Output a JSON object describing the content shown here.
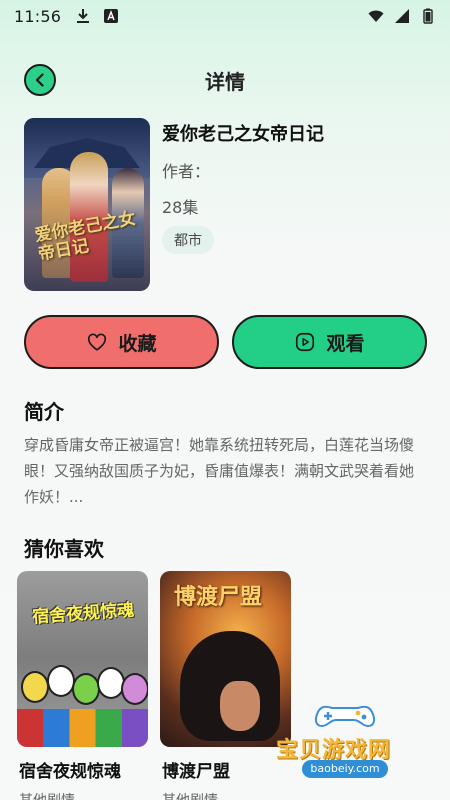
{
  "status_bar": {
    "time": "11:56"
  },
  "header": {
    "title": "详情"
  },
  "drama": {
    "title": "爱你老己之女帝日记",
    "author_label": "作者：",
    "episodes": "28集",
    "tag": "都市",
    "cover_text": "爱你老己之女帝日记"
  },
  "actions": {
    "favorite_label": "收藏",
    "watch_label": "观看"
  },
  "intro": {
    "title": "简介",
    "text": "穿成昏庸女帝正被逼宫！她靠系统扭转死局，白莲花当场傻眼！又强纳敌国质子为妃，昏庸值爆表！满朝文武哭着看她作妖！..."
  },
  "recommendations": {
    "title": "猜你喜欢",
    "items": [
      {
        "name": "宿舍夜规惊魂",
        "genre": "其他剧情",
        "cover_text": "宿舍夜规惊魂"
      },
      {
        "name": "博渡尸盟",
        "genre": "其他剧情",
        "cover_text": "博渡尸盟"
      }
    ]
  },
  "watermark": {
    "text": "宝贝游戏网",
    "url": "baobeiy.com"
  },
  "colors": {
    "accent_green": "#23cf87",
    "favorite_red": "#f06f6d",
    "tag_bg": "#e3f2ec"
  },
  "icons": {
    "back": "chevron-left-icon",
    "favorite": "heart-icon",
    "watch": "play-icon"
  }
}
